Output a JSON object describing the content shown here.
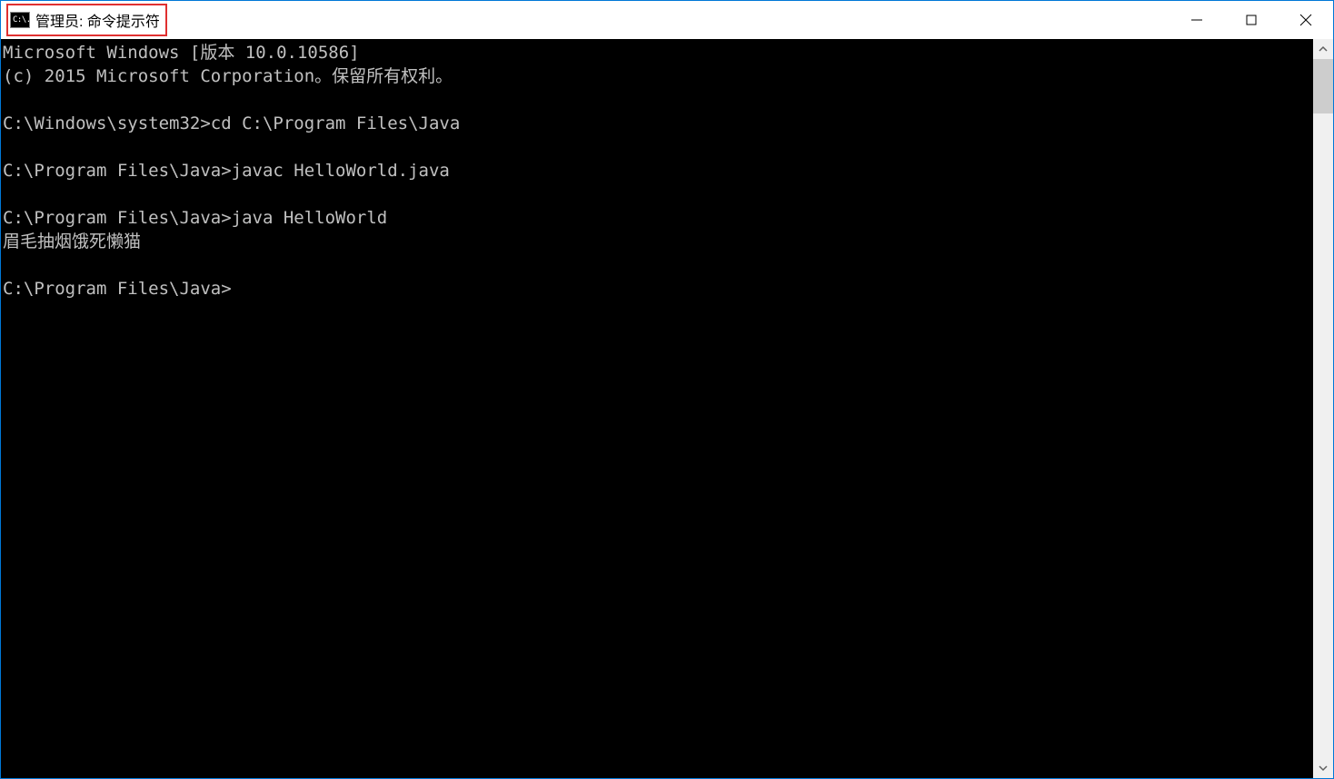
{
  "window": {
    "title": "管理员: 命令提示符",
    "app_icon_text": "C:\\."
  },
  "terminal": {
    "lines": [
      "Microsoft Windows [版本 10.0.10586]",
      "(c) 2015 Microsoft Corporation。保留所有权利。",
      "",
      "C:\\Windows\\system32>cd C:\\Program Files\\Java",
      "",
      "C:\\Program Files\\Java>javac HelloWorld.java",
      "",
      "C:\\Program Files\\Java>java HelloWorld",
      "眉毛抽烟饿死懒猫",
      "",
      "C:\\Program Files\\Java>"
    ]
  }
}
